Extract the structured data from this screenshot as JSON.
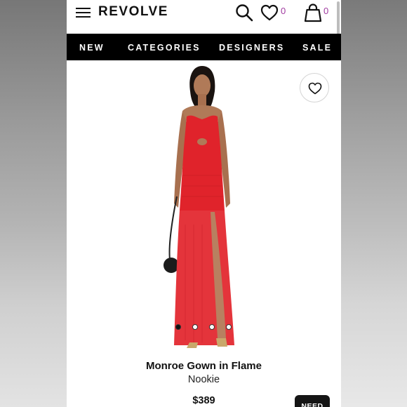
{
  "header": {
    "logo": "REVOLVE",
    "wishlist_count": "0",
    "bag_count": "0"
  },
  "nav": {
    "items": [
      "NEW",
      "CATEGORIES",
      "DESIGNERS",
      "SALE"
    ]
  },
  "product": {
    "title": "Monroe Gown in Flame",
    "brand": "Nookie",
    "price": "$389",
    "dress_color": "#e0232b",
    "image_dots": 4,
    "active_dot": 1
  },
  "help_button": "NEED"
}
